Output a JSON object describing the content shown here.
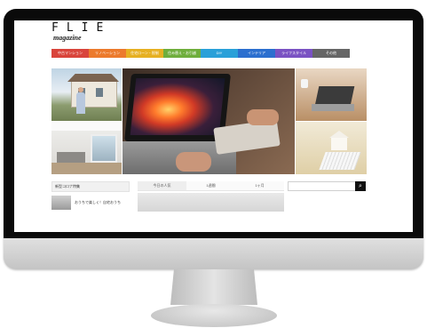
{
  "site": {
    "logo": "FLIE",
    "tagline": "magazine"
  },
  "nav": {
    "items": [
      {
        "label": "中古マンション",
        "color": "#d9443b"
      },
      {
        "label": "リノベーション",
        "color": "#ec7a2c"
      },
      {
        "label": "住宅ローン・税制",
        "color": "#e6b022"
      },
      {
        "label": "住み替え・お引越",
        "color": "#6fae3c"
      },
      {
        "label": "DIY",
        "color": "#29a0d9"
      },
      {
        "label": "インテリア",
        "color": "#2b6fcf"
      },
      {
        "label": "ライフスタイル",
        "color": "#7a52c3"
      },
      {
        "label": "その他",
        "color": "#666666"
      }
    ]
  },
  "sidebar": {
    "heading": "新型コロナ特集",
    "item_text": "おうちで楽しく！自宅おうち"
  },
  "tabs": [
    {
      "label": "今日の人気",
      "active": true
    },
    {
      "label": "1週間",
      "active": false
    },
    {
      "label": "1ヶ月",
      "active": false
    }
  ],
  "search": {
    "icon": "search-icon"
  }
}
